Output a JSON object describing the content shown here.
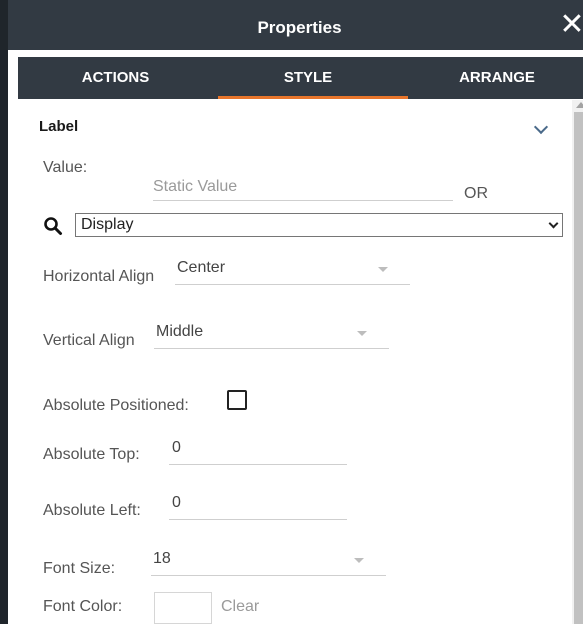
{
  "header": {
    "title": "Properties",
    "close_glyph": "✕"
  },
  "tabs": [
    {
      "label": "ACTIONS"
    },
    {
      "label": "STYLE",
      "active": true
    },
    {
      "label": "ARRANGE"
    }
  ],
  "accent_color": "#e8752b",
  "section": {
    "label": "Label"
  },
  "value": {
    "label": "Value:",
    "placeholder": "Static Value",
    "or_text": "OR"
  },
  "display_select": {
    "selected": "Display"
  },
  "horizontal_align": {
    "label": "Horizontal Align",
    "value": "Center"
  },
  "vertical_align": {
    "label": "Vertical Align",
    "value": "Middle"
  },
  "absolute_positioned": {
    "label": "Absolute Positioned:",
    "checked": false
  },
  "absolute_top": {
    "label": "Absolute Top:",
    "value": "0"
  },
  "absolute_left": {
    "label": "Absolute Left:",
    "value": "0"
  },
  "font_size": {
    "label": "Font Size:",
    "value": "18"
  },
  "font_color": {
    "label": "Font Color:",
    "clear_label": "Clear",
    "swatch_color": "#ffffff"
  }
}
